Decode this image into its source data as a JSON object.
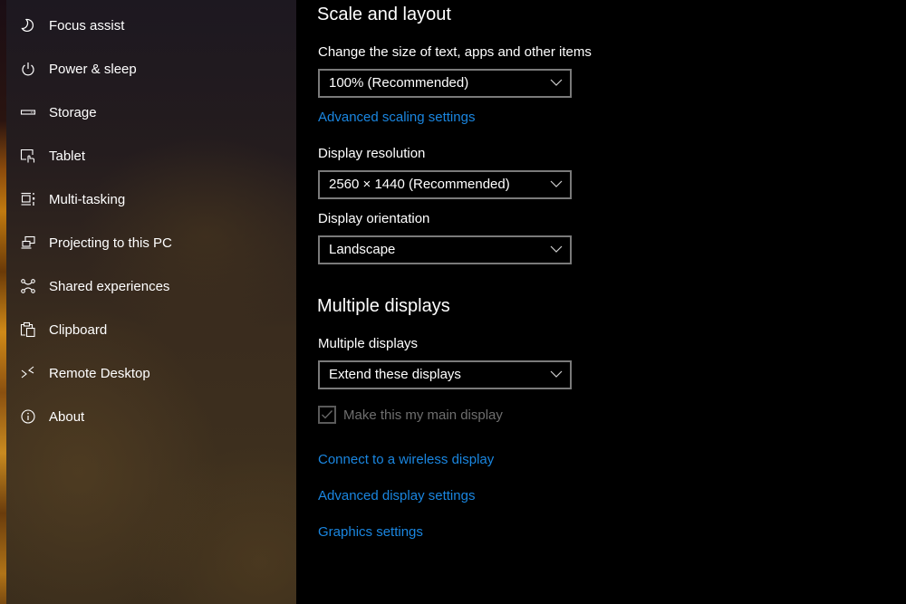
{
  "sidebar": {
    "items": [
      {
        "label": "Focus assist",
        "icon": "moon-icon"
      },
      {
        "label": "Power & sleep",
        "icon": "power-icon"
      },
      {
        "label": "Storage",
        "icon": "storage-drive-icon"
      },
      {
        "label": "Tablet",
        "icon": "tablet-touch-icon"
      },
      {
        "label": "Multi-tasking",
        "icon": "multitasking-icon"
      },
      {
        "label": "Projecting to this PC",
        "icon": "projecting-icon"
      },
      {
        "label": "Shared experiences",
        "icon": "shared-experiences-icon"
      },
      {
        "label": "Clipboard",
        "icon": "clipboard-icon"
      },
      {
        "label": "Remote Desktop",
        "icon": "remote-desktop-icon"
      },
      {
        "label": "About",
        "icon": "info-icon"
      }
    ]
  },
  "main": {
    "scale_section": {
      "title": "Scale and layout",
      "size_label": "Change the size of text, apps and other items",
      "size_value": "100% (Recommended)",
      "advanced_scaling_link": "Advanced scaling settings",
      "resolution_label": "Display resolution",
      "resolution_value": "2560 × 1440 (Recommended)",
      "orientation_label": "Display orientation",
      "orientation_value": "Landscape"
    },
    "multiple_section": {
      "title": "Multiple displays",
      "label": "Multiple displays",
      "value": "Extend these displays",
      "main_display_checkbox": {
        "label": "Make this my main display",
        "checked": true,
        "disabled": true
      },
      "links": [
        "Connect to a wireless display",
        "Advanced display settings",
        "Graphics settings"
      ]
    }
  },
  "colors": {
    "link": "#1a86e0",
    "dropdown_border": "#7a7a7a",
    "disabled_text": "#6e6e6e",
    "background": "#000000"
  }
}
